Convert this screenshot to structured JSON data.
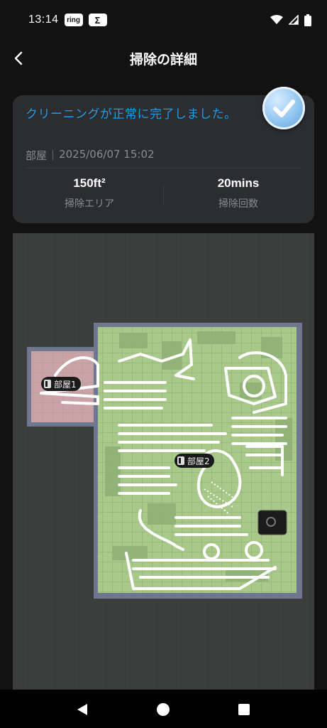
{
  "status_bar": {
    "time": "13:14",
    "badge1": "ring",
    "badge2": "Σ",
    "icons": [
      "wifi-icon",
      "signal-icon",
      "battery-icon"
    ]
  },
  "header": {
    "title": "掃除の詳細",
    "back_icon": "chevron-left-icon"
  },
  "summary": {
    "message": "クリーニングが正常に完了しました。",
    "room": "部屋",
    "separator": "|",
    "datetime": "2025/06/07 15:02",
    "area_value": "150ft²",
    "area_label": "掃除エリア",
    "time_value": "20mins",
    "time_label": "掃除回数",
    "message_color": "#1e9be9"
  },
  "map": {
    "rooms": [
      {
        "label": "部屋1",
        "color": "#c9a3a8"
      },
      {
        "label": "部屋2",
        "color": "#a8c98a"
      }
    ],
    "wall_color": "#6e7690",
    "background_color": "#3a3d3c"
  },
  "nav": {
    "back": "triangle-back-icon",
    "home": "circle-home-icon",
    "recents": "square-recents-icon"
  }
}
